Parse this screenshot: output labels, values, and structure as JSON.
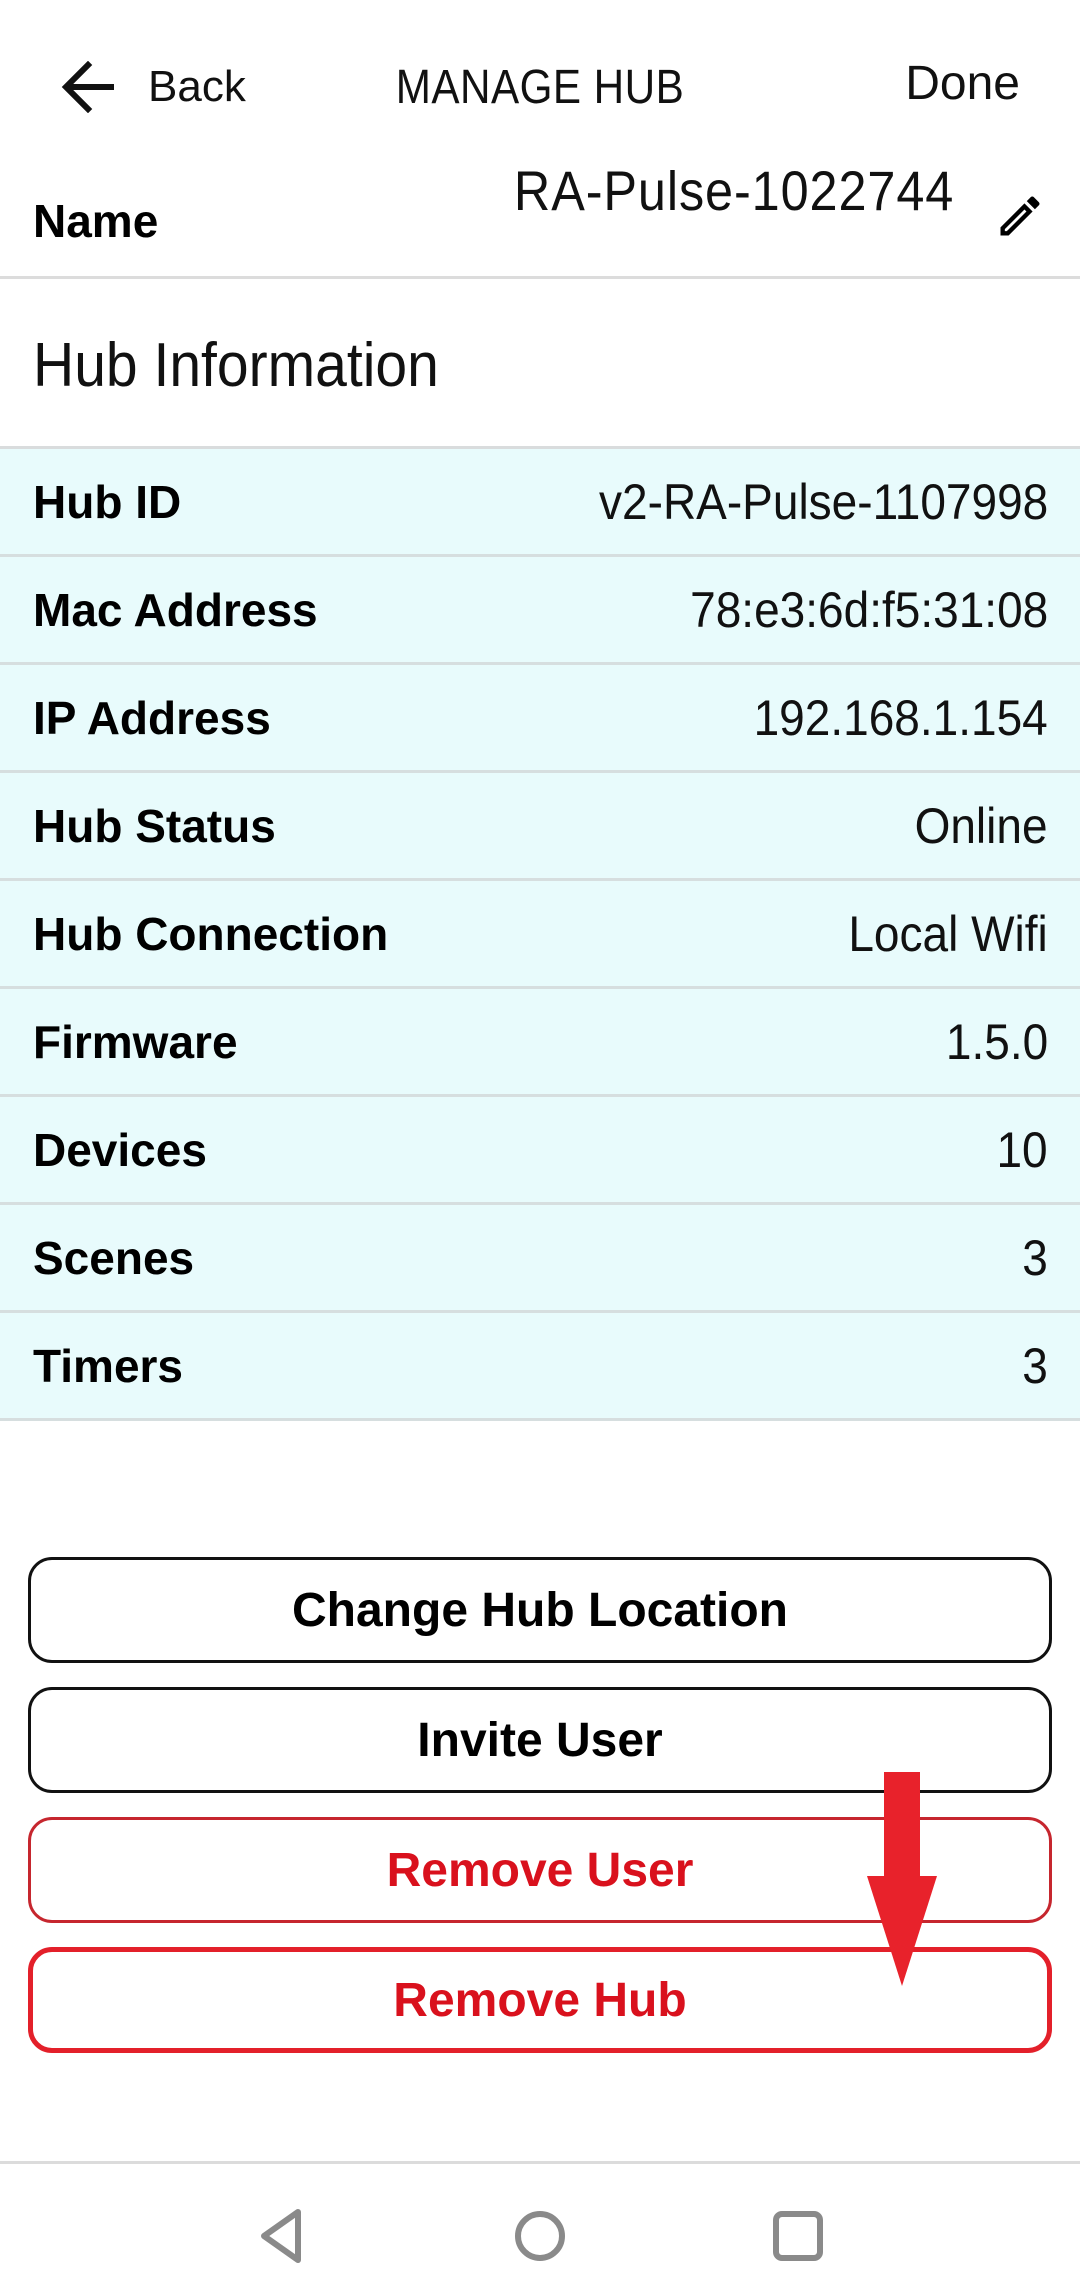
{
  "header": {
    "back_label": "Back",
    "title": "MANAGE HUB",
    "done_label": "Done",
    "back_icon": "arrow-left-icon"
  },
  "name_field": {
    "label": "Name",
    "value": "RA-Pulse-1022744",
    "edit_icon": "pencil-icon"
  },
  "hub_info": {
    "title": "Hub Information",
    "rows": [
      {
        "label": "Hub ID",
        "value": "v2-RA-Pulse-1107998"
      },
      {
        "label": "Mac Address",
        "value": "78:e3:6d:f5:31:08"
      },
      {
        "label": "IP Address",
        "value": "192.168.1.154"
      },
      {
        "label": "Hub Status",
        "value": "Online"
      },
      {
        "label": "Hub Connection",
        "value": "Local Wifi"
      },
      {
        "label": "Firmware",
        "value": "1.5.0"
      },
      {
        "label": "Devices",
        "value": "10"
      },
      {
        "label": "Scenes",
        "value": "3"
      },
      {
        "label": "Timers",
        "value": "3"
      }
    ]
  },
  "actions": {
    "change_location": "Change Hub Location",
    "invite_user": "Invite User",
    "remove_user": "Remove User",
    "remove_hub": "Remove Hub"
  },
  "annotation": {
    "type": "arrow-down",
    "target": "Remove Hub",
    "color": "#e8222b"
  },
  "colors": {
    "row_background": "#e8fbfc",
    "danger": "#d9111d",
    "divider": "#d9dcdd"
  },
  "system_nav": {
    "back_icon": "nav-back-triangle-icon",
    "home_icon": "nav-home-circle-icon",
    "recents_icon": "nav-recents-square-icon"
  }
}
